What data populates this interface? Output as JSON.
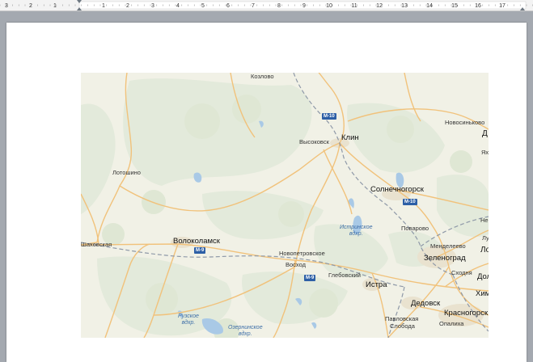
{
  "ruler": {
    "numbers": [
      "3",
      "2",
      "1",
      "1",
      "2",
      "3",
      "4",
      "5",
      "6",
      "7",
      "8",
      "9",
      "10",
      "11",
      "12",
      "13",
      "14",
      "15",
      "16",
      "17"
    ]
  },
  "map": {
    "towns": {
      "kozlovo": "Козлово",
      "novosinkovo": "Новосиньково",
      "d_edge": "Д",
      "ya_edge": "Ях",
      "vysokovsk": "Высоковск",
      "klin": "Клин",
      "lotoshino": "Лотошино",
      "solnechnogorsk": "Солнечногорск",
      "nekr_edge": "Некр",
      "lu_edge": "Лу",
      "lo_edge": "Ло",
      "shakhovskaya": "Шаховская",
      "volokolamsk": "Волоколамск",
      "povarovo": "Поварово",
      "mendeleevo": "Менделеево",
      "novopetrovskoe": "Новопетровское",
      "voskhod": "Восход",
      "zelenograd": "Зеленоград",
      "skhodnya": "Сходня",
      "dolg_edge": "Долг",
      "khimk_edge": "Химк",
      "glebovsky": "Глебовский",
      "istra": "Истра",
      "dedovsk": "Дедовск",
      "krasnogorsk": "Красногорск",
      "pavlovskaya": "Павловская",
      "sloboda": "Слобода",
      "opalikha": "Опалиха"
    },
    "water": {
      "istrinskoe_1": "Истринское",
      "istrinskoe_2": "вдхр.",
      "ruzskoe_1": "Рузское",
      "ruzskoe_2": "вдхр.",
      "ozerninskoe_1": "Озернинское",
      "ozerninskoe_2": "вдхр."
    },
    "shields": {
      "m10_north": "М-10",
      "m10_south": "М-10",
      "m9_west": "М-9",
      "m9_east": "М-9"
    },
    "colors": {
      "land": "#f1f1e6",
      "forest": "#e4ebdb",
      "road": "#f1c27b",
      "water": "#a9c9e6",
      "railway": "#8f99a8",
      "shield": "#2d5fa6"
    }
  }
}
